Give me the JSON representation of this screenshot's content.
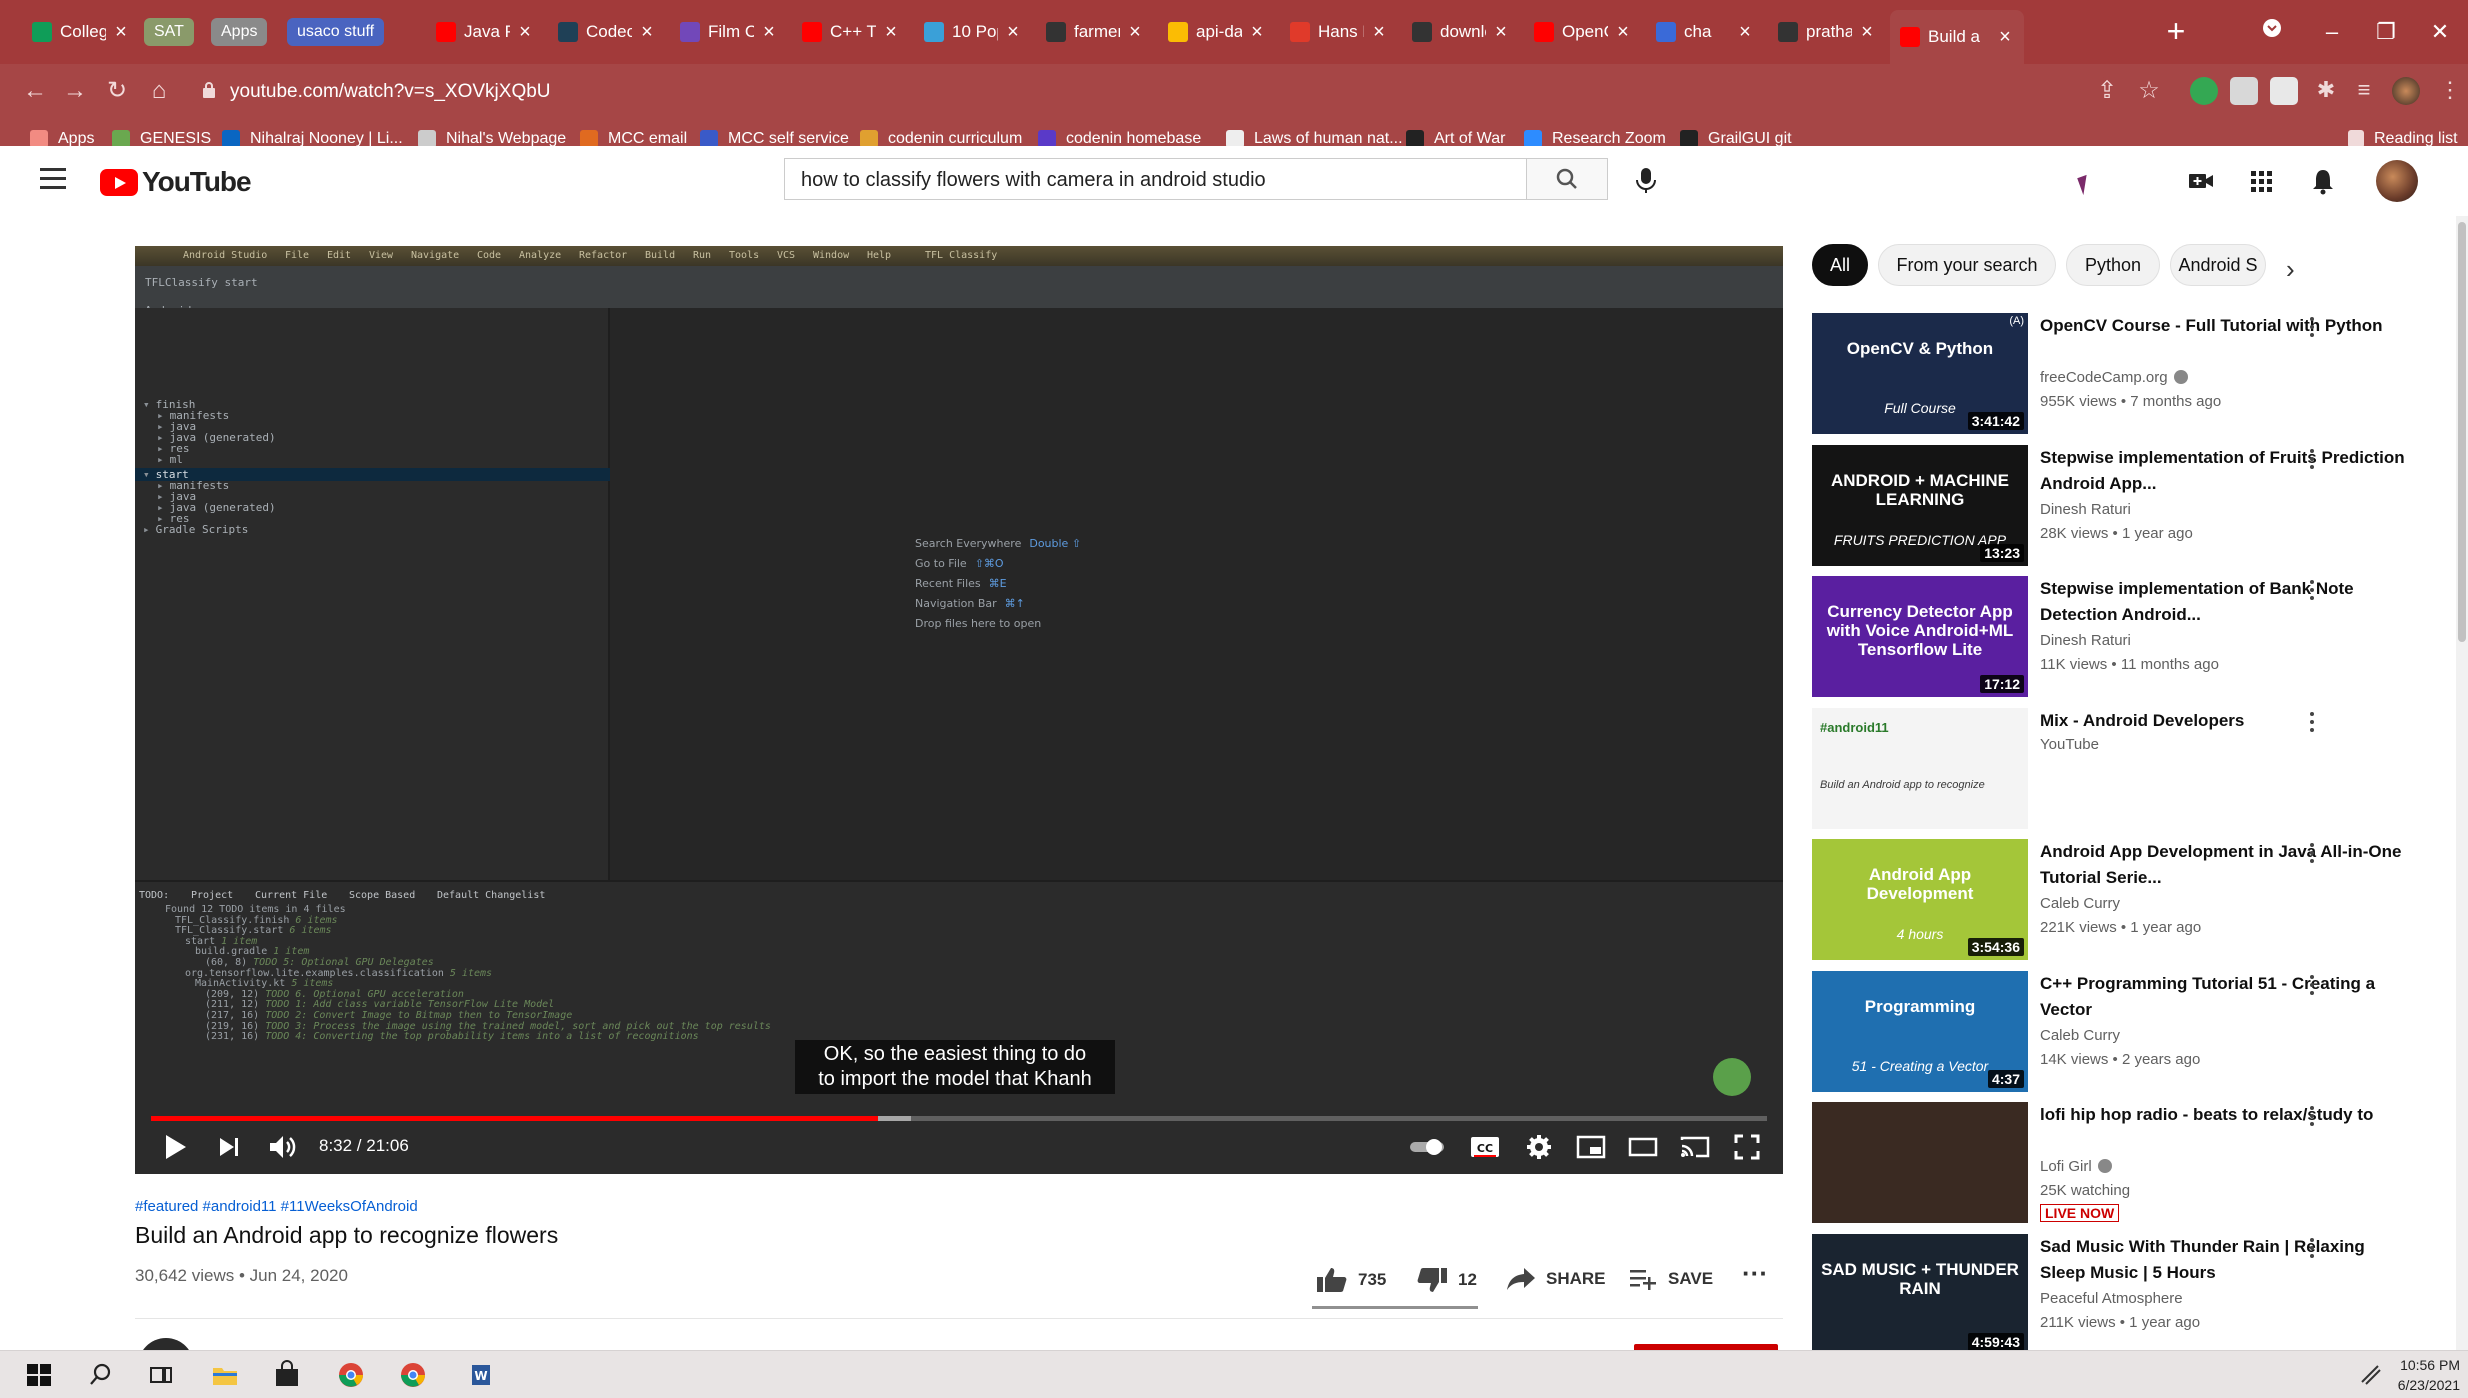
{
  "browser": {
    "tabs": [
      {
        "label": "Colleg",
        "icon": "google-sheets-icon",
        "color": "#0f9d58"
      },
      {
        "label": "SAT",
        "kind": "chip",
        "color": "#8a9a6a"
      },
      {
        "label": "Apps",
        "kind": "chip",
        "color": "#8a8a8a"
      },
      {
        "label": "usaco stuff",
        "kind": "chip",
        "color": "#4a64c0"
      },
      {
        "label": "Java Pr",
        "icon": "youtube-icon",
        "color": "#ff0000"
      },
      {
        "label": "Codeca",
        "icon": "codecademy-icon",
        "color": "#1f4056"
      },
      {
        "label": "Film Cl",
        "icon": "google-forms-icon",
        "color": "#7248b9"
      },
      {
        "label": "C++ Tu",
        "icon": "youtube-icon",
        "color": "#ff0000"
      },
      {
        "label": "10 Pop",
        "icon": "atom-icon",
        "color": "#3aa0d8"
      },
      {
        "label": "farmer",
        "icon": "github-icon",
        "color": "#333333"
      },
      {
        "label": "api-da",
        "icon": "google-drive-icon",
        "color": "#fbbc04"
      },
      {
        "label": "Hans R",
        "icon": "t-icon",
        "color": "#e03a2a"
      },
      {
        "label": "downlo",
        "icon": "github-icon",
        "color": "#333333"
      },
      {
        "label": "OpenG",
        "icon": "youtube-icon",
        "color": "#ff0000"
      },
      {
        "label": "cha",
        "icon": "github-blue-icon",
        "color": "#3a6ad8"
      },
      {
        "label": "prathar",
        "icon": "github-icon",
        "color": "#333333"
      },
      {
        "label": "Build a",
        "icon": "youtube-icon",
        "color": "#ff0000",
        "active": true
      }
    ],
    "new_tab": "+",
    "window_controls": {
      "minimize": "–",
      "restore": "❐",
      "close": "✕"
    },
    "url": "youtube.com/watch?v=s_XOVkjXQbU",
    "bookmarks": [
      {
        "label": "Apps",
        "icon": "apps-grid-icon",
        "color": "#f28b82"
      },
      {
        "label": "GENESIS",
        "icon": "genesis-icon",
        "color": "#6aa84f"
      },
      {
        "label": "Nihalraj Nooney | Li...",
        "icon": "linkedin-icon",
        "color": "#0a66c2"
      },
      {
        "label": "Nihal's Webpage",
        "icon": "globe-icon",
        "color": "#cccccc"
      },
      {
        "label": "MCC email",
        "icon": "mcc-icon",
        "color": "#e06a20"
      },
      {
        "label": "MCC self service",
        "icon": "mcc-shield-icon",
        "color": "#3a5ac8"
      },
      {
        "label": "codenin curriculum",
        "icon": "codenin-icon",
        "color": "#e0a030"
      },
      {
        "label": "codenin homebase",
        "icon": "h-icon",
        "color": "#5a3ac8"
      },
      {
        "label": "Laws of human nat...",
        "icon": "book-icon",
        "color": "#eeeeee"
      },
      {
        "label": "Art of War",
        "icon": "yin-yang-icon",
        "color": "#222222"
      },
      {
        "label": "Research Zoom",
        "icon": "zoom-icon",
        "color": "#2d8cff"
      },
      {
        "label": "GrailGUI git",
        "icon": "github-icon",
        "color": "#222222"
      }
    ],
    "reading_list": "Reading list"
  },
  "youtube": {
    "logo_text": "YouTube",
    "search_query": "how to classify flowers with camera in android studio",
    "player": {
      "caption_line1": "OK, so the easiest thing to do",
      "caption_line2": "to import the model that Khanh",
      "time": "8:32 / 21:06",
      "progress": 0.45,
      "buffered": 0.47
    },
    "screen_content": {
      "menu": [
        "Android Studio",
        "File",
        "Edit",
        "View",
        "Navigate",
        "Code",
        "Analyze",
        "Refactor",
        "Build",
        "Run",
        "Tools",
        "VCS",
        "Window",
        "Help"
      ],
      "window_title": "TFL Classify",
      "breadcrumb": "TFLClassify   start",
      "panel_label": "Android",
      "tree": [
        "finish",
        "manifests",
        "java",
        "java (generated)",
        "res",
        "ml",
        "start",
        "manifests",
        "java",
        "java (generated)",
        "res",
        "Gradle Scripts"
      ],
      "hints": [
        {
          "text": "Search Everywhere",
          "key": "Double ⇧"
        },
        {
          "text": "Go to File",
          "key": "⇧⌘O"
        },
        {
          "text": "Recent Files",
          "key": "⌘E"
        },
        {
          "text": "Navigation Bar",
          "key": "⌘↑"
        },
        {
          "text": "Drop files here to open",
          "key": ""
        }
      ],
      "todo_tabs": [
        "TODO:",
        "Project",
        "Current File",
        "Scope Based",
        "Default Changelist"
      ],
      "todo_rows": [
        {
          "text": "Found 12 TODO items in 4 files",
          "todo": ""
        },
        {
          "text": "TFL_Classify.finish",
          "todo": "6 items"
        },
        {
          "text": "TFL_Classify.start",
          "todo": "6 items"
        },
        {
          "text": "start",
          "todo": "1 item"
        },
        {
          "text": "build.gradle",
          "todo": "1 item"
        },
        {
          "text": "(60, 8)",
          "todo": "TODO 5: Optional GPU Delegates"
        },
        {
          "text": "org.tensorflow.lite.examples.classification",
          "todo": "5 items"
        },
        {
          "text": "MainActivity.kt",
          "todo": "5 items"
        },
        {
          "text": "(209, 12)",
          "todo": "TODO 6. Optional GPU acceleration"
        },
        {
          "text": "(211, 12)",
          "todo": "TODO 1: Add class variable TensorFlow Lite Model"
        },
        {
          "text": "(217, 16)",
          "todo": "TODO 2: Convert Image to Bitmap then to TensorImage"
        },
        {
          "text": "(219, 16)",
          "todo": "TODO 3: Process the image using the trained model, sort and pick out the top results"
        },
        {
          "text": "(231, 16)",
          "todo": "TODO 4: Converting the top probability items into a list of recognitions"
        }
      ]
    },
    "video": {
      "tags": "#featured #android11 #11WeeksOfAndroid",
      "title": "Build an Android app to recognize flowers",
      "stats": "30,642 views • Jun 24, 2020",
      "likes": "735",
      "dislikes": "12",
      "share_label": "SHARE",
      "save_label": "SAVE",
      "more": "···"
    },
    "chips": [
      "All",
      "From your search",
      "Python",
      "Android S"
    ],
    "recommendations": [
      {
        "title": "OpenCV Course - Full Tutorial with Python",
        "channel": "freeCodeCamp.org",
        "verified": true,
        "meta": "955K views • 7 months ago",
        "duration": "3:41:42",
        "thumb_text": "OpenCV & Python",
        "thumb_sub": "Full Course",
        "thumb_bg": "#1b2a4a",
        "badge": "(A)"
      },
      {
        "title": "Stepwise implementation of Fruits Prediction Android App...",
        "channel": "Dinesh Raturi",
        "meta": "28K views • 1 year ago",
        "duration": "13:23",
        "thumb_text": "ANDROID + MACHINE LEARNING",
        "thumb_sub": "FRUITS PREDICTION APP",
        "thumb_bg": "#141414"
      },
      {
        "title": "Stepwise implementation of Bank Note Detection Android...",
        "channel": "Dinesh Raturi",
        "meta": "11K views • 11 months ago",
        "duration": "17:12",
        "thumb_text": "Currency Detector App with Voice Android+ML Tensorflow Lite",
        "thumb_bg": "#5a1fa0"
      },
      {
        "title": "Mix - Android Developers",
        "channel": "YouTube",
        "meta": "",
        "duration": "",
        "thumb_text": "#android11",
        "thumb_sub": "Build an Android app to recognize",
        "thumb_bg": "#f4f4f4"
      },
      {
        "title": "Android App Development in Java All-in-One Tutorial Serie...",
        "channel": "Caleb Curry",
        "meta": "221K views • 1 year ago",
        "duration": "3:54:36",
        "thumb_text": "Android App Development",
        "thumb_sub": "4 hours",
        "thumb_bg": "#a4c639"
      },
      {
        "title": "C++ Programming Tutorial 51 - Creating a Vector",
        "channel": "Caleb Curry",
        "meta": "14K views • 2 years ago",
        "duration": "4:37",
        "thumb_text": "Programming",
        "thumb_sub": "51 - Creating a Vector",
        "thumb_bg": "#1f6fb0"
      },
      {
        "title": "lofi hip hop radio - beats to relax/study to",
        "channel": "Lofi Girl",
        "verified": true,
        "meta": "25K watching",
        "live": "LIVE NOW",
        "duration": "",
        "thumb_bg": "#3a2a22"
      },
      {
        "title": "Sad Music With Thunder Rain | Relaxing Sleep Music | 5 Hours",
        "channel": "Peaceful Atmosphere",
        "meta": "211K views • 1 year ago",
        "duration": "4:59:43",
        "thumb_text": "SAD MUSIC + THUNDER RAIN",
        "thumb_bg": "#1a2430"
      }
    ]
  },
  "taskbar": {
    "time": "10:56 PM",
    "date": "6/23/2021"
  }
}
